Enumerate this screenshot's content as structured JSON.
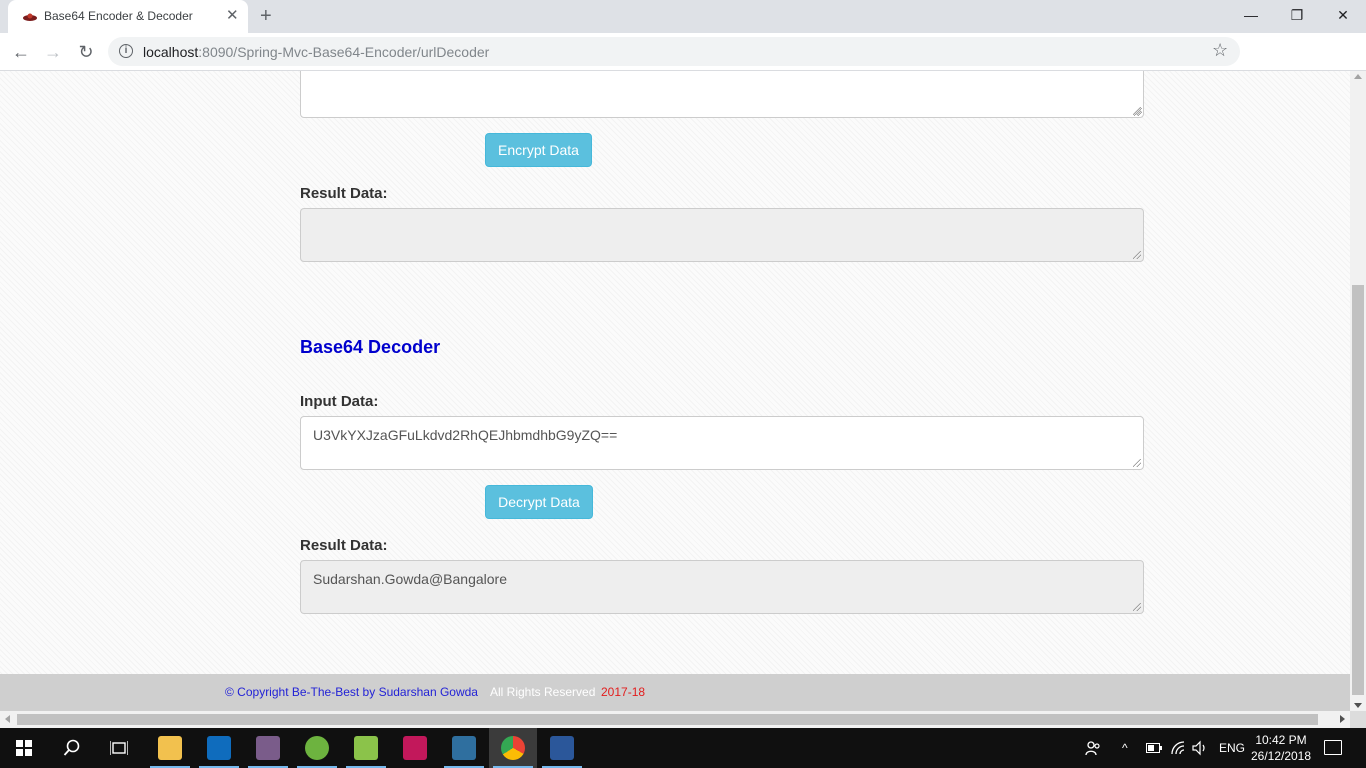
{
  "browser": {
    "tab_title": "Base64 Encoder & Decoder",
    "tab_close": "✕",
    "new_tab": "+",
    "url_host": "localhost",
    "url_path": ":8090/Spring-Mvc-Base64-Encoder/urlDecoder",
    "window_minimize": "—",
    "window_restore": "❐",
    "window_close": "✕"
  },
  "encoder": {
    "input_value": "",
    "button_label": "Encrypt Data",
    "result_label": "Result Data:",
    "result_value": ""
  },
  "decoder": {
    "title": "Base64 Decoder",
    "input_label": "Input Data:",
    "input_value": "U3VkYXJzaGFuLkdvd2RhQEJhbmdhbG9yZQ==",
    "button_label": "Decrypt Data",
    "result_label": "Result Data:",
    "result_value": "Sudarshan.Gowda@Bangalore"
  },
  "footer": {
    "copyright": "© Copyright Be-The-Best by Sudarshan Gowda",
    "rights": "All Rights Reserved",
    "years": "2017-18"
  },
  "taskbar": {
    "apps": [
      {
        "name": "file-explorer",
        "color": "#f2c14e"
      },
      {
        "name": "outlook",
        "color": "#0f6cbd"
      },
      {
        "name": "game-app",
        "color": "#7a5c8a"
      },
      {
        "name": "spring-tool-suite",
        "color": "#6db33f"
      },
      {
        "name": "notepad-plus-plus",
        "color": "#8bc34a"
      },
      {
        "name": "database-tool",
        "color": "#c2185b"
      },
      {
        "name": "mysql-workbench",
        "color": "#2f6f9f"
      },
      {
        "name": "chrome",
        "color": "#ea4335"
      },
      {
        "name": "word",
        "color": "#2b579a"
      }
    ],
    "language": "ENG",
    "time": "10:42 PM",
    "date": "26/12/2018"
  }
}
